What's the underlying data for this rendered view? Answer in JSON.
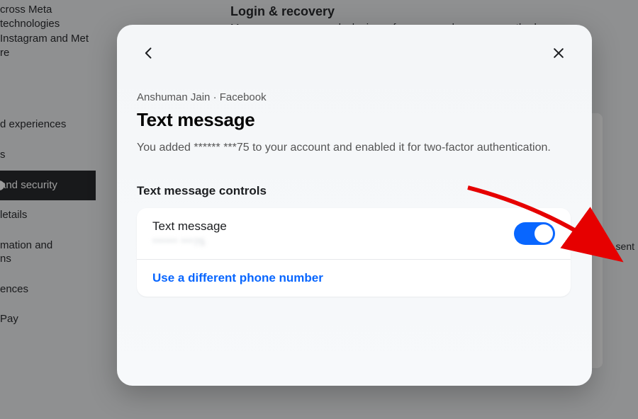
{
  "background": {
    "intro_line1": "cross Meta technologies",
    "intro_line2": "Instagram and Met",
    "intro_line3": "re",
    "sidebar": {
      "items": [
        {
          "label": "d experiences"
        },
        {
          "label": "s"
        },
        {
          "label": "and security"
        },
        {
          "label": "letails"
        },
        {
          "label": "mation and\nns"
        },
        {
          "label": "ences"
        },
        {
          "label": "Pay"
        }
      ]
    },
    "main": {
      "heading": "Login & recovery",
      "desc_fragment": "Manage your passwords, login preferences and recovery methods"
    },
    "right_hint": "mails sent"
  },
  "modal": {
    "breadcrumb": "Anshuman Jain · Facebook",
    "title": "Text message",
    "description": "You added ****** ***75 to your account and enabled it for two-factor authentication.",
    "section_label": "Text message controls",
    "row": {
      "title": "Text message",
      "sub_masked": "****** ***75",
      "toggle_on": true
    },
    "alt_link": "Use a different phone number"
  }
}
